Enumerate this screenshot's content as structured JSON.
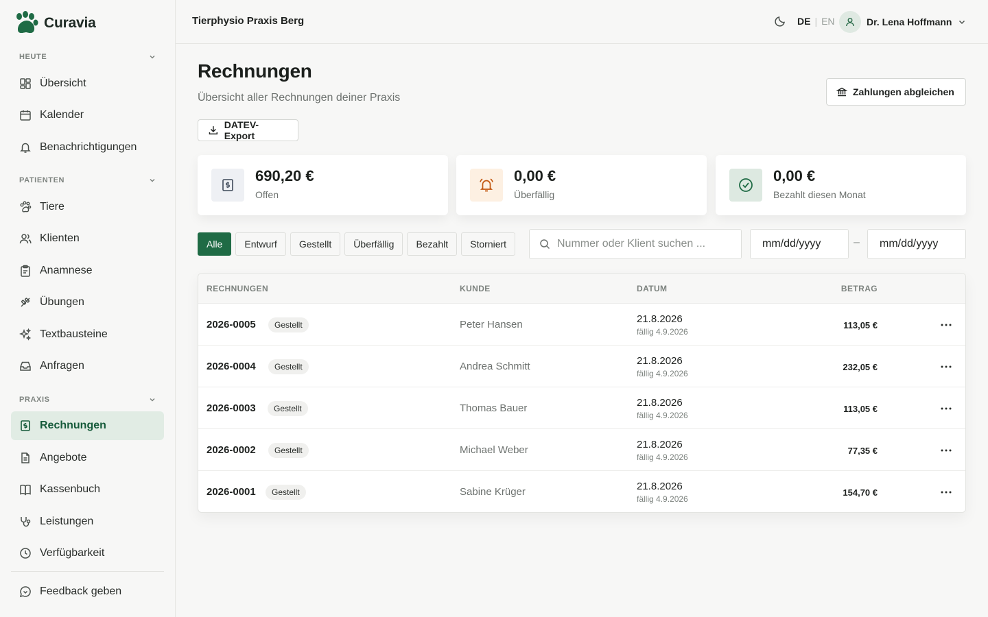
{
  "brand": {
    "name": "Curavia"
  },
  "sidebar": {
    "sections": [
      {
        "label": "HEUTE"
      },
      {
        "label": "PATIENTEN"
      },
      {
        "label": "PRAXIS"
      }
    ],
    "items": [
      {
        "label": "Übersicht",
        "icon": "dashboard-icon"
      },
      {
        "label": "Kalender",
        "icon": "calendar-icon"
      },
      {
        "label": "Benachrichtigungen",
        "icon": "bell-icon"
      },
      {
        "label": "Tiere",
        "icon": "paw-icon"
      },
      {
        "label": "Klienten",
        "icon": "users-icon"
      },
      {
        "label": "Anamnese",
        "icon": "clipboard-icon"
      },
      {
        "label": "Übungen",
        "icon": "exercise-icon"
      },
      {
        "label": "Textbausteine",
        "icon": "sparkles-icon"
      },
      {
        "label": "Anfragen",
        "icon": "inbox-icon"
      },
      {
        "label": "Rechnungen",
        "icon": "invoice-icon",
        "active": true
      },
      {
        "label": "Angebote",
        "icon": "document-icon"
      },
      {
        "label": "Kassenbuch",
        "icon": "book-icon"
      },
      {
        "label": "Leistungen",
        "icon": "stethoscope-icon"
      },
      {
        "label": "Verfügbarkeit",
        "icon": "clock-icon"
      }
    ],
    "feedback": {
      "label": "Feedback geben",
      "icon": "feedback-icon"
    }
  },
  "header": {
    "practice": "Tierphysio Praxis Berg",
    "lang_active": "DE",
    "lang_sep": "|",
    "lang_inactive": "EN",
    "user": "Dr. Lena Hoffmann"
  },
  "page": {
    "title": "Rechnungen",
    "subtitle": "Übersicht aller Rechnungen deiner Praxis",
    "match_button": "Zahlungen abgleichen",
    "export_button": "DATEV-Export"
  },
  "stats": [
    {
      "value": "690,20 €",
      "label": "Offen",
      "icon": "receipt-icon",
      "color": "#eef0f4"
    },
    {
      "value": "0,00 €",
      "label": "Überfällig",
      "icon": "alarm-bell-icon",
      "color": "#fdf0e2"
    },
    {
      "value": "0,00 €",
      "label": "Bezahlt diesen Monat",
      "icon": "check-circle-icon",
      "color": "#dde9e1"
    }
  ],
  "filters": [
    "Alle",
    "Entwurf",
    "Gestellt",
    "Überfällig",
    "Bezahlt",
    "Storniert"
  ],
  "active_filter": "Alle",
  "search": {
    "placeholder": "Nummer oder Klient suchen ..."
  },
  "date_from": "mm/dd/yyyy",
  "date_sep": "–",
  "date_to": "mm/dd/yyyy",
  "table": {
    "headers": [
      "RECHNUNGEN",
      "KUNDE",
      "DATUM",
      "BETRAG"
    ],
    "rows": [
      {
        "number": "2026-0005",
        "status": "Gestellt",
        "client": "Peter Hansen",
        "date": "21.8.2026",
        "due": "fällig 4.9.2026",
        "amount": "113,05 €"
      },
      {
        "number": "2026-0004",
        "status": "Gestellt",
        "client": "Andrea Schmitt",
        "date": "21.8.2026",
        "due": "fällig 4.9.2026",
        "amount": "232,05 €"
      },
      {
        "number": "2026-0003",
        "status": "Gestellt",
        "client": "Thomas Bauer",
        "date": "21.8.2026",
        "due": "fällig 4.9.2026",
        "amount": "113,05 €"
      },
      {
        "number": "2026-0002",
        "status": "Gestellt",
        "client": "Michael Weber",
        "date": "21.8.2026",
        "due": "fällig 4.9.2026",
        "amount": "77,35 €"
      },
      {
        "number": "2026-0001",
        "status": "Gestellt",
        "client": "Sabine Krüger",
        "date": "21.8.2026",
        "due": "fällig 4.9.2026",
        "amount": "154,70 €"
      }
    ]
  },
  "colors": {
    "accent": "#1f6b45",
    "active_bg": "#e1ece4"
  }
}
